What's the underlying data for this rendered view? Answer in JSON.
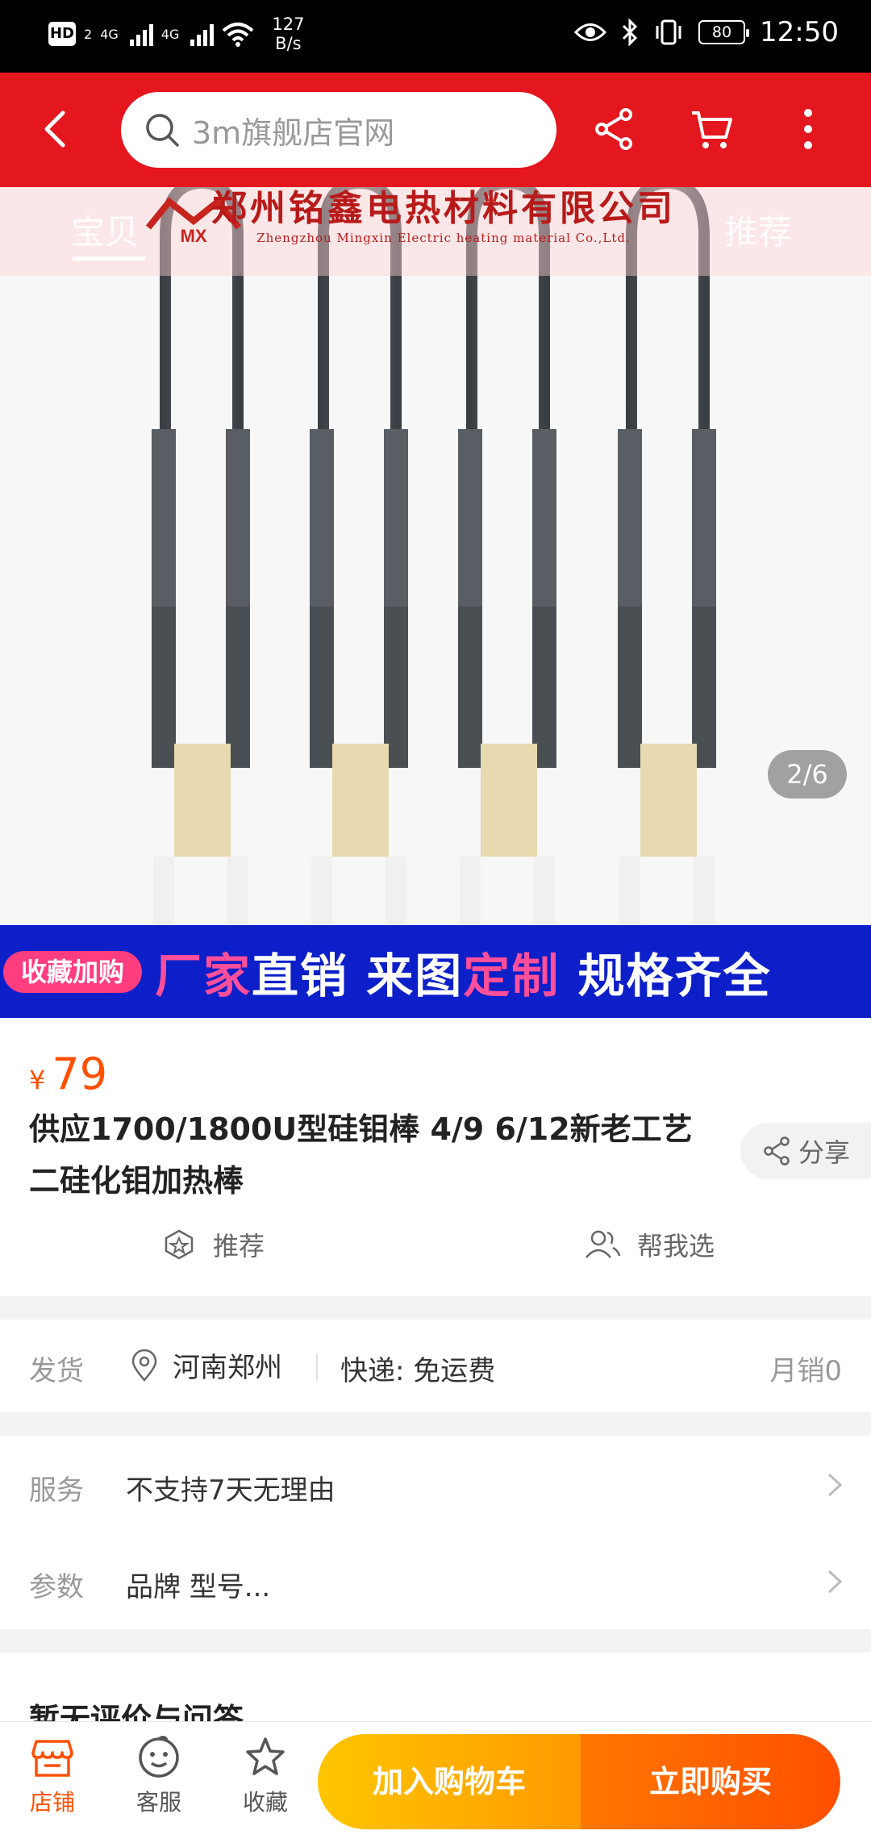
{
  "status_bar": {
    "hd": "HD",
    "sim": "2",
    "net1": "4G",
    "net2": "4G",
    "speed_value": "127",
    "speed_unit": "B/s",
    "battery": "80",
    "time": "12:50"
  },
  "top_nav": {
    "search_placeholder": "3m旗舰店官网",
    "icons": [
      "back-icon",
      "search-icon",
      "share-icon",
      "cart-icon",
      "more-icon"
    ]
  },
  "gallery": {
    "ghost_tabs": [
      "宝贝",
      "推荐"
    ],
    "brand_cn": "郑州铭鑫电热材料有限公司",
    "brand_en": "Zhengzhou Mingxin Electric heating material Co.,Ltd.",
    "brand_logo": "MX",
    "banner_tag": "收藏加购",
    "banner_parts": [
      "厂家",
      "直销 来图",
      "定制",
      " 规格齐全"
    ],
    "page_indicator": "2/6"
  },
  "product": {
    "currency": "¥",
    "price": "79",
    "title": "供应1700/1800U型硅钼棒 4/9 6/12新老工艺二硅化钼加热棒",
    "share_label": "分享",
    "recommend_label": "推荐",
    "help_choose_label": "帮我选"
  },
  "shipping": {
    "label": "发货",
    "location": "河南郑州",
    "express": "快递: 免运费",
    "monthly_sales": "月销0"
  },
  "service": {
    "label": "服务",
    "value": "不支持7天无理由"
  },
  "params": {
    "label": "参数",
    "value": "品牌 型号..."
  },
  "reviews": {
    "title": "暂无评价与问答"
  },
  "bottom_bar": {
    "store": "店铺",
    "service": "客服",
    "favorite": "收藏",
    "add_to_cart": "加入购物车",
    "buy_now": "立即购买"
  },
  "colors": {
    "nav_red": "#e4161e",
    "price_orange": "#ff5000",
    "banner_blue": "#0d1fc8",
    "cart_yellow": "#ffc500",
    "buy_orange": "#ff4f00"
  }
}
